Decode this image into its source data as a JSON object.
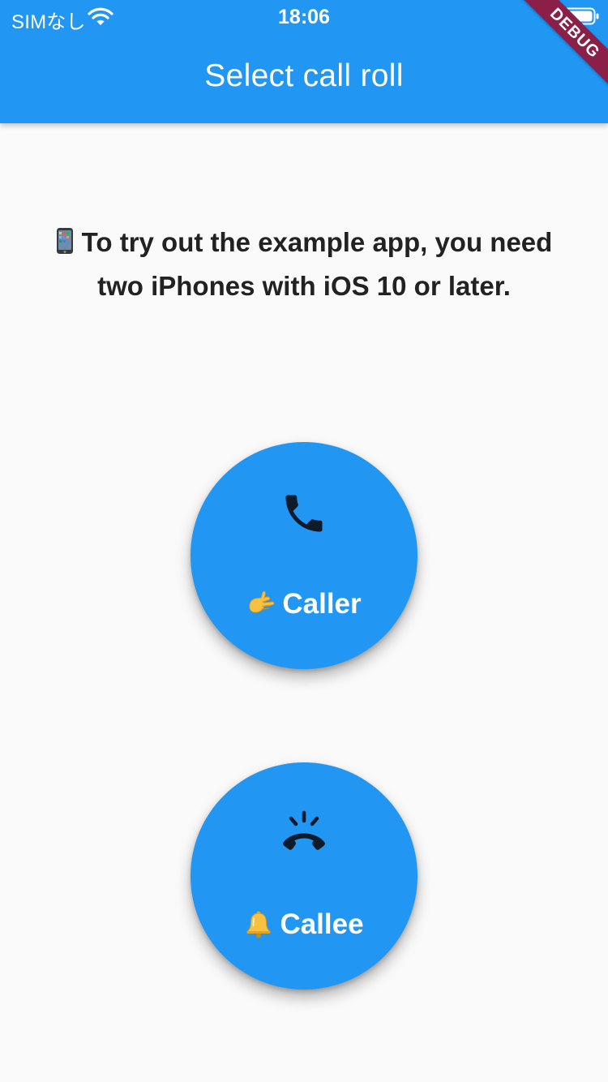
{
  "status_bar": {
    "carrier": "SIMなし",
    "time": "18:06"
  },
  "app_bar": {
    "title": "Select call roll",
    "debug_banner": "DEBUG"
  },
  "instructions": {
    "text": "To try out the example app, you need two iPhones with iOS 10 or later.",
    "icon": "mobile-phone-emoji"
  },
  "buttons": {
    "caller": {
      "label": "Caller",
      "icon": "phone-icon",
      "emoji": "call-me-hand-emoji"
    },
    "callee": {
      "label": "Callee",
      "icon": "ringing-phone-icon",
      "emoji": "bell-emoji"
    }
  },
  "colors": {
    "primary": "#2196f3",
    "background": "#fafafa",
    "text": "#222222",
    "icon": "#0d1b2a",
    "debug": "#8b1f47"
  }
}
